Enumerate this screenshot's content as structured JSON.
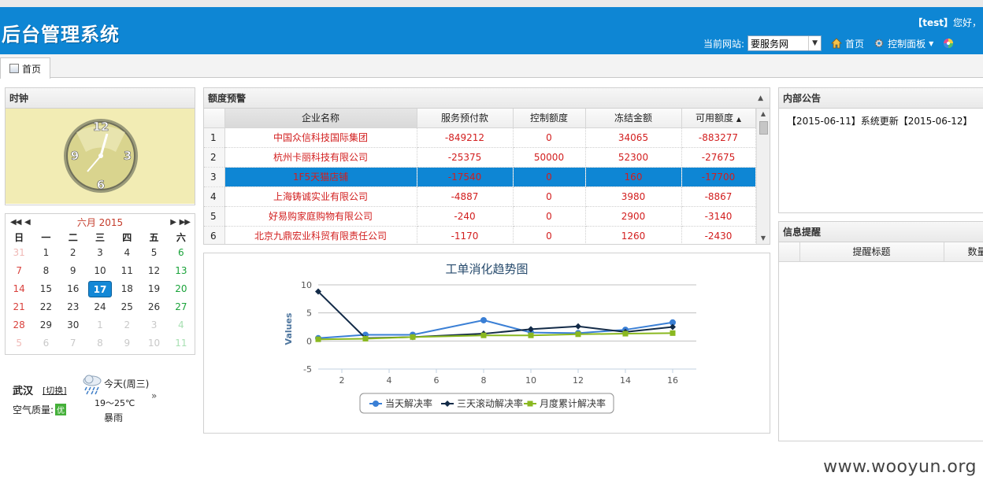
{
  "app": {
    "title": "后台管理系统"
  },
  "header": {
    "welcome_user": "【test】",
    "welcome_text": "您好，",
    "site_label": "当前网站:",
    "site_value": "要服务网",
    "nav_home": "首页",
    "nav_control_panel": "控制面板"
  },
  "tabs": [
    {
      "label": "首页"
    }
  ],
  "clock": {
    "title": "时钟",
    "numbers": [
      "12",
      "3",
      "6",
      "9"
    ]
  },
  "calendar": {
    "month_label": "六月 2015",
    "weekdays": [
      "日",
      "一",
      "二",
      "三",
      "四",
      "五",
      "六"
    ],
    "today": "17",
    "weeks": [
      [
        "31",
        "1",
        "2",
        "3",
        "4",
        "5",
        "6"
      ],
      [
        "7",
        "8",
        "9",
        "10",
        "11",
        "12",
        "13"
      ],
      [
        "14",
        "15",
        "16",
        "17",
        "18",
        "19",
        "20"
      ],
      [
        "21",
        "22",
        "23",
        "24",
        "25",
        "26",
        "27"
      ],
      [
        "28",
        "29",
        "30",
        "1",
        "2",
        "3",
        "4"
      ],
      [
        "5",
        "6",
        "7",
        "8",
        "9",
        "10",
        "11"
      ]
    ]
  },
  "weather": {
    "city": "武汉",
    "switch_label": "[切换]",
    "air_label": "空气质量:",
    "air_value": "优",
    "day_label": "今天(周三)",
    "temp": "19～25℃",
    "desc": "暴雨",
    "more": "»"
  },
  "quota_alert": {
    "title": "额度预警",
    "columns": [
      "企业名称",
      "服务预付款",
      "控制额度",
      "冻结金额",
      "可用额度"
    ],
    "sorted_column_indicator": "▲",
    "selected_row": 3,
    "rows": [
      {
        "n": "1",
        "name": "中国众信科技国际集团",
        "prepay": "-849212",
        "limit": "0",
        "frozen": "34065",
        "avail": "-883277"
      },
      {
        "n": "2",
        "name": "杭州卡丽科技有限公司",
        "prepay": "-25375",
        "limit": "50000",
        "frozen": "52300",
        "avail": "-27675"
      },
      {
        "n": "3",
        "name": "1F5天猫店铺",
        "prepay": "-17540",
        "limit": "0",
        "frozen": "160",
        "avail": "-17700"
      },
      {
        "n": "4",
        "name": "上海铸诚实业有限公司",
        "prepay": "-4887",
        "limit": "0",
        "frozen": "3980",
        "avail": "-8867"
      },
      {
        "n": "5",
        "name": "好易购家庭购物有限公司",
        "prepay": "-240",
        "limit": "0",
        "frozen": "2900",
        "avail": "-3140"
      },
      {
        "n": "6",
        "name": "北京九鼎宏业科贸有限责任公司",
        "prepay": "-1170",
        "limit": "0",
        "frozen": "1260",
        "avail": "-2430"
      }
    ]
  },
  "chart_data": {
    "type": "line",
    "title": "工单消化趋势图",
    "ylabel": "Values",
    "xlabel": "",
    "x": [
      1,
      3,
      5,
      8,
      10,
      12,
      14,
      16
    ],
    "xticks": [
      2,
      4,
      6,
      8,
      10,
      12,
      14,
      16
    ],
    "yticks": [
      10,
      5,
      0,
      -5
    ],
    "xlim": [
      1,
      17
    ],
    "ylim": [
      -5,
      10
    ],
    "grid": true,
    "legend_position": "bottom",
    "series": [
      {
        "name": "当天解决率",
        "color": "#3a7fd5",
        "marker": "circle",
        "values": [
          0.5,
          1.1,
          1.1,
          3.7,
          1.5,
          1.4,
          2.0,
          3.3
        ]
      },
      {
        "name": "三天滚动解决率",
        "color": "#132b48",
        "marker": "diamond",
        "values": [
          8.8,
          0.5,
          0.7,
          1.3,
          2.1,
          2.6,
          1.6,
          2.5
        ]
      },
      {
        "name": "月度累计解决率",
        "color": "#8ab820",
        "marker": "square",
        "values": [
          0.3,
          0.4,
          0.7,
          1.0,
          1.0,
          1.2,
          1.3,
          1.4
        ]
      }
    ]
  },
  "notice": {
    "title": "内部公告",
    "text": "【2015-06-11】系统更新【2015-06-12】"
  },
  "reminder": {
    "title": "信息提醒",
    "columns": [
      "提醒标题",
      "数量"
    ]
  },
  "watermark": "www.wooyun.org"
}
